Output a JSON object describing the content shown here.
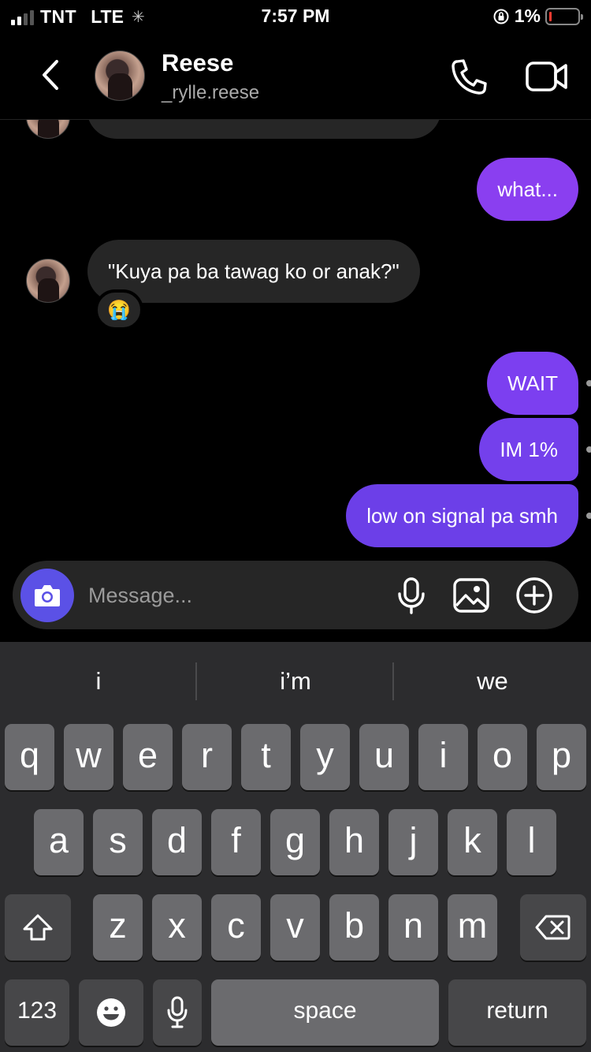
{
  "status_bar": {
    "carrier": "TNT",
    "network": "LTE",
    "time": "7:57 PM",
    "battery_percent": "1%",
    "signal_bars_active": 2,
    "battery_level": 0.01,
    "battery_color": "#ff3b30"
  },
  "header": {
    "name": "Reese",
    "handle": "_rylle.reese",
    "icons": [
      "back-chevron-icon",
      "phone-icon",
      "video-camera-icon"
    ]
  },
  "messages": [
    {
      "from": "them",
      "text": ""
    },
    {
      "from": "me",
      "text": "what..."
    },
    {
      "from": "them",
      "text": "\"Kuya pa ba tawag ko or anak?\"",
      "reaction": "😭"
    },
    {
      "from": "me",
      "text": "WAIT"
    },
    {
      "from": "me",
      "text": "IM 1%"
    },
    {
      "from": "me",
      "text": "low on signal pa smh"
    }
  ],
  "composer": {
    "placeholder": "Message...",
    "icons": [
      "camera-icon",
      "microphone-icon",
      "gallery-icon",
      "plus-circle-icon"
    ],
    "accent": "#5b51e6"
  },
  "keyboard": {
    "suggestions": [
      "i",
      "i’m",
      "we"
    ],
    "row1": [
      "q",
      "w",
      "e",
      "r",
      "t",
      "y",
      "u",
      "i",
      "o",
      "p"
    ],
    "row2": [
      "a",
      "s",
      "d",
      "f",
      "g",
      "h",
      "j",
      "k",
      "l"
    ],
    "row3": [
      "z",
      "x",
      "c",
      "v",
      "b",
      "n",
      "m"
    ],
    "numbers_label": "123",
    "space_label": "space",
    "return_label": "return"
  },
  "colors": {
    "outgoing_gradient_top": "#8a3ff0",
    "outgoing_gradient_bottom": "#6c3fe8",
    "incoming_bubble": "#262626"
  }
}
